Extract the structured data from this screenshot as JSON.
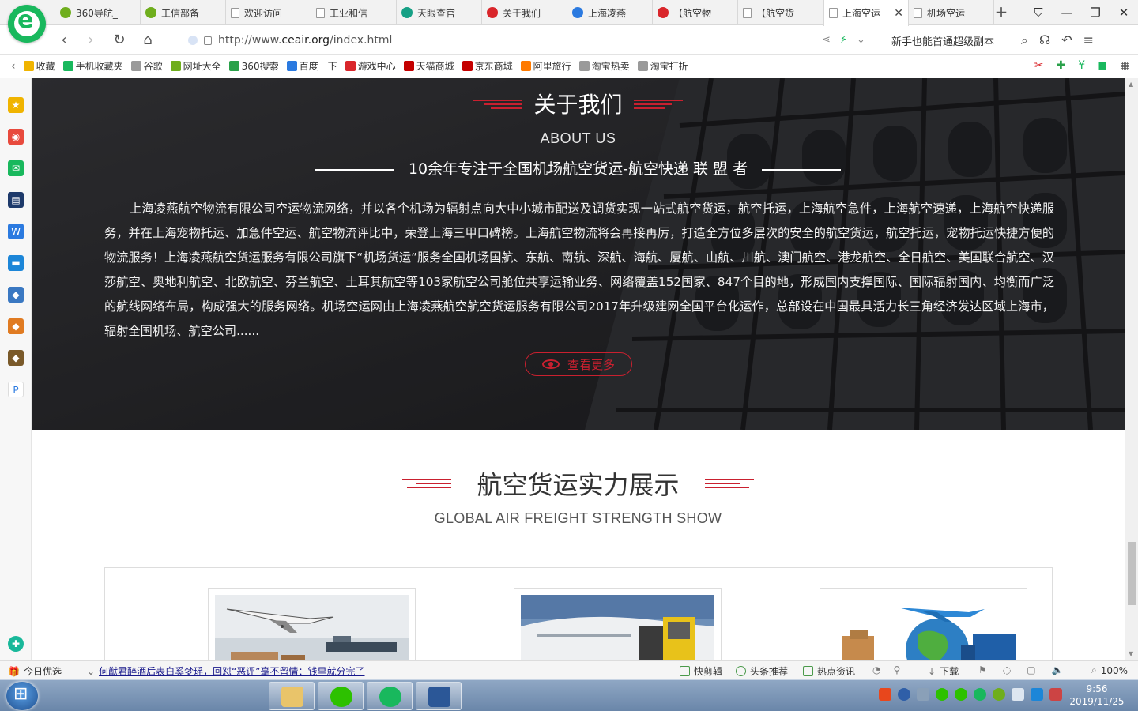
{
  "browser": {
    "tabs": [
      {
        "title": "360导航_",
        "icon": "olive"
      },
      {
        "title": "工信部备",
        "icon": "olive"
      },
      {
        "title": "欢迎访问",
        "icon": "doc"
      },
      {
        "title": "工业和信",
        "icon": "doc"
      },
      {
        "title": "天眼查官",
        "icon": "teal"
      },
      {
        "title": "关于我们",
        "icon": "red"
      },
      {
        "title": "上海凌燕",
        "icon": "blue"
      },
      {
        "title": "【航空物",
        "icon": "red"
      },
      {
        "title": "【航空货",
        "icon": "doc"
      },
      {
        "title": "上海空运",
        "icon": "doc",
        "active": true
      },
      {
        "title": "机场空运",
        "icon": "doc"
      }
    ],
    "new_tab": "+",
    "url_prefix": "http://www.",
    "url_domain": "ceair.org",
    "url_path": "/index.html",
    "slogan": "新手也能首通超级副本",
    "bookmarks": [
      {
        "label": "收藏",
        "color": "#f0b400"
      },
      {
        "label": "手机收藏夹",
        "color": "#19b85d"
      },
      {
        "label": "谷歌",
        "color": "#9a9a9a"
      },
      {
        "label": "网址大全",
        "color": "#6fae1d"
      },
      {
        "label": "360搜索",
        "color": "#2aa14a"
      },
      {
        "label": "百度一下",
        "color": "#2b7ae0"
      },
      {
        "label": "游戏中心",
        "color": "#d9262b"
      },
      {
        "label": "天猫商城",
        "color": "#c40000"
      },
      {
        "label": "京东商城",
        "color": "#c40000"
      },
      {
        "label": "阿里旅行",
        "color": "#ff7a00"
      },
      {
        "label": "淘宝热卖",
        "color": "#9a9a9a"
      },
      {
        "label": "淘宝打折",
        "color": "#9a9a9a"
      }
    ]
  },
  "about": {
    "title": "关于我们",
    "title_en": "ABOUT US",
    "subtitle": "10余年专注于全国机场航空货运-航空快递 联 盟 者",
    "body": "上海凌燕航空物流有限公司空运物流网络，并以各个机场为辐射点向大中小城市配送及调货实现一站式航空货运，航空托运，上海航空急件，上海航空速递，上海航空快递服务，并在上海宠物托运、加急件空运、航空物流评比中，荣登上海三甲口碑榜。上海航空物流将会再接再厉，打造全方位多层次的安全的航空货运，航空托运，宠物托运快捷方便的物流服务！上海凌燕航空货运服务有限公司旗下“机场货运”服务全国机场国航、东航、南航、深航、海航、厦航、山航、川航、澳门航空、港龙航空、全日航空、美国联合航空、汉莎航空、奥地利航空、北欧航空、芬兰航空、土耳其航空等103家航空公司舱位共享运输业务、网络覆盖152国家、847个目的地，形成国内支撑国际、国际辐射国内、均衡而广泛的航线网络布局，构成强大的服务网络。机场空运网由上海凌燕航空航空货运服务有限公司2017年升级建网全国平台化运作，总部设在中国最具活力长三角经济发达区域上海市，辐射全国机场、航空公司......",
    "more_label": "查看更多"
  },
  "strength": {
    "title": "航空货运实力展示",
    "title_en": "GLOBAL AIR FREIGHT STRENGTH SHOW"
  },
  "statusbar": {
    "today": "今日优选",
    "news": "何猷君醉酒后表白奚梦瑶，回怼“恶评”毫不留情：钱早就分完了",
    "items": [
      "快剪辑",
      "头条推荐",
      "热点资讯",
      "下载"
    ],
    "zoom": "100%"
  },
  "taskbar": {
    "time": "9:56",
    "date": "2019/11/25"
  },
  "colors": {
    "accent_red": "#c9202f",
    "browser_green": "#19b85d"
  }
}
